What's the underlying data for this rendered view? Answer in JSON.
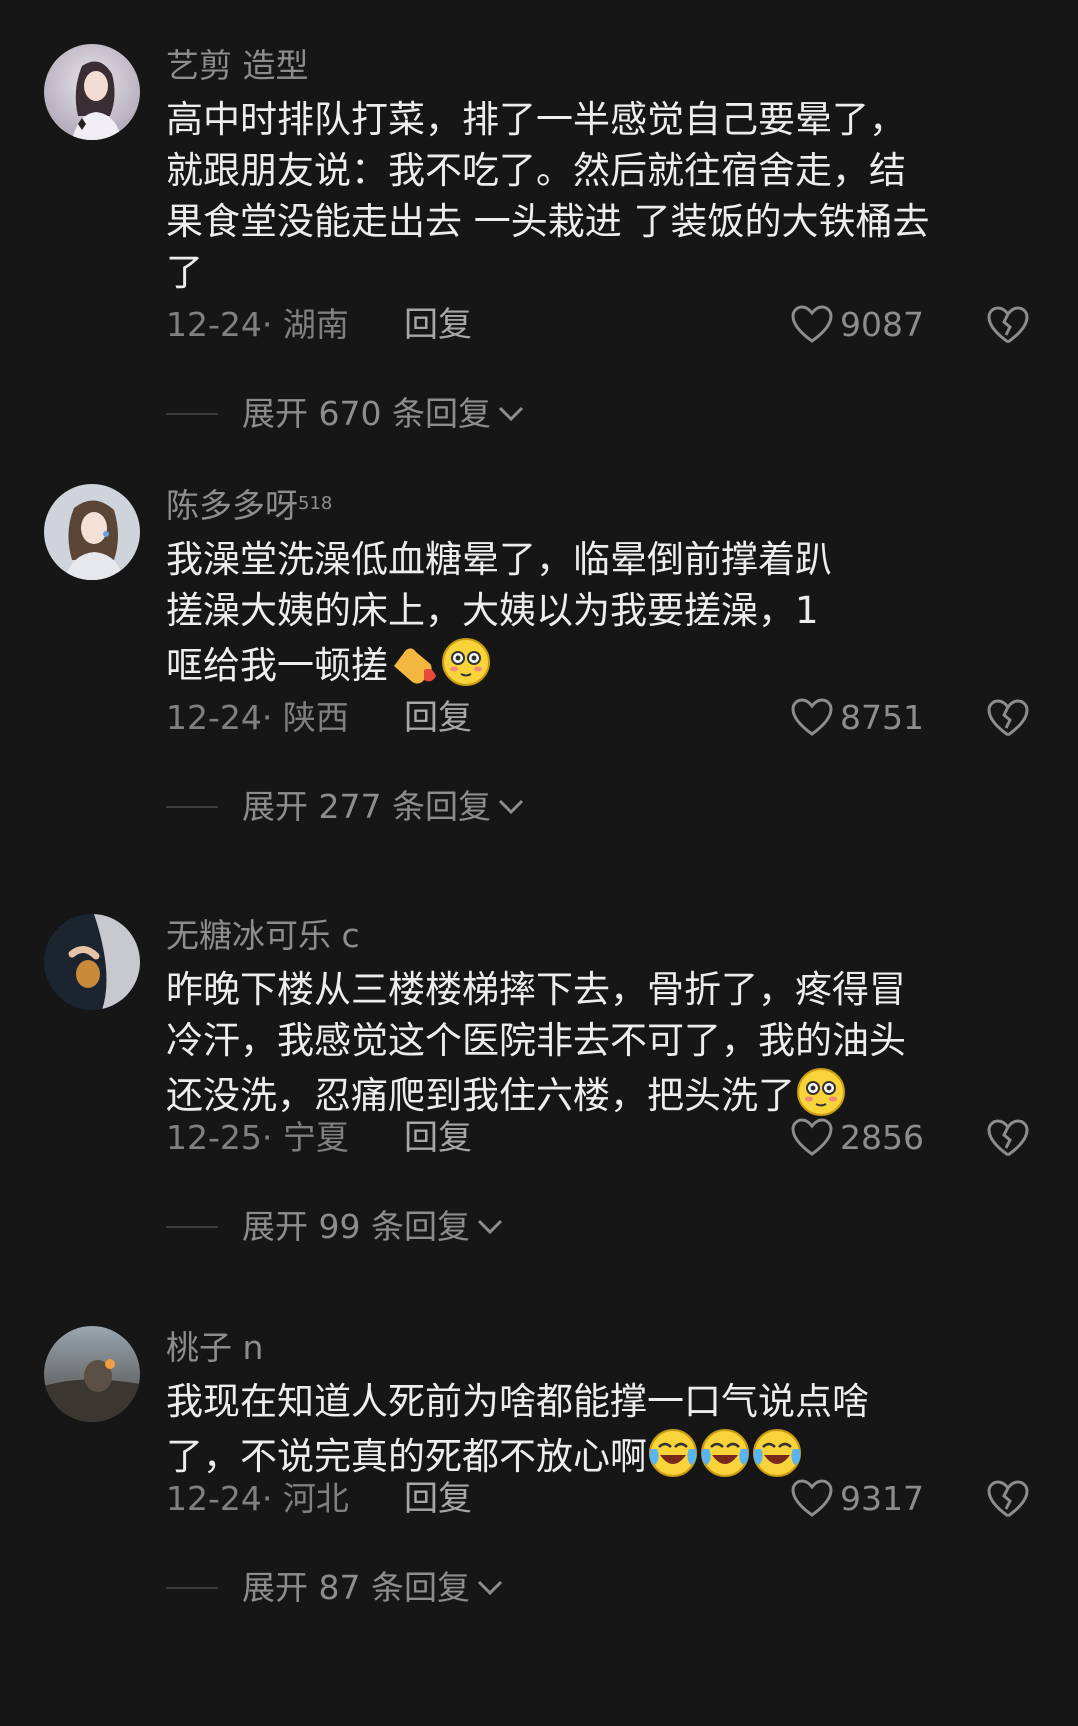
{
  "comments": [
    {
      "username": "艺剪 造型",
      "badge": "",
      "lines": [
        "高中时排队打菜，排了一半感觉自己要晕了，",
        "就跟朋友说：我不吃了。然后就往宿舍走，结",
        "果食堂没能走出去 一头栽进 了装饭的大铁桶去",
        "了"
      ],
      "emojis": [],
      "date_location": "12-24· 湖南",
      "reply_label": "回复",
      "likes": "9087",
      "expand_label": "展开 670 条回复"
    },
    {
      "username": "陈多多呀",
      "badge": "518",
      "lines": [
        "我澡堂洗澡低血糖晕了，临晕倒前撑着趴",
        "搓澡大姨的床上，大姨以为我要搓澡，1",
        "哐给我一顿搓"
      ],
      "emojis": [
        "point-emoji",
        "flushed-emoji"
      ],
      "date_location": "12-24· 陕西",
      "reply_label": "回复",
      "likes": "8751",
      "expand_label": "展开 277 条回复"
    },
    {
      "username": "无糖冰可乐 c",
      "badge": "",
      "lines": [
        "昨晚下楼从三楼楼梯摔下去，骨折了，疼得冒",
        "冷汗，我感觉这个医院非去不可了，我的油头",
        "还没洗，忍痛爬到我住六楼，把头洗了"
      ],
      "emojis": [
        "flushed-emoji"
      ],
      "date_location": "12-25· 宁夏",
      "reply_label": "回复",
      "likes": "2856",
      "expand_label": "展开 99 条回复"
    },
    {
      "username": "桃子 n",
      "badge": "",
      "lines": [
        "我现在知道人死前为啥都能撑一口气说点啥",
        "了，不说完真的死都不放心啊"
      ],
      "emojis": [
        "crying-laugh-emoji",
        "crying-laugh-emoji",
        "crying-laugh-emoji"
      ],
      "date_location": "12-24· 河北",
      "reply_label": "回复",
      "likes": "9317",
      "expand_label": "展开 87 条回复"
    }
  ],
  "colors": {
    "background": "#161616",
    "text": "#ededed",
    "muted": "#8d8d8d"
  }
}
